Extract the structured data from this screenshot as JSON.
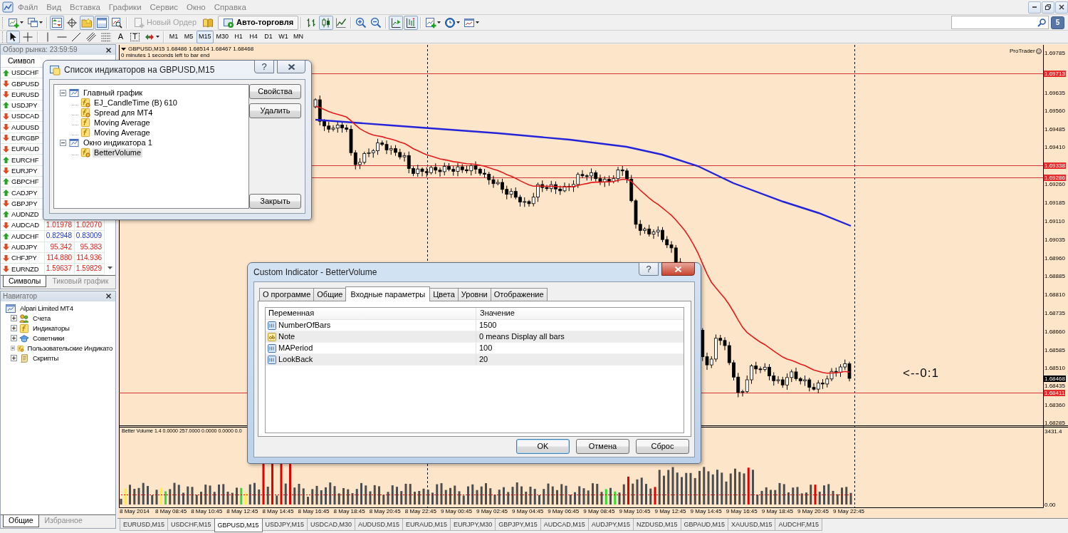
{
  "menu_bar": {
    "items": [
      {
        "label": "Файл"
      },
      {
        "label": "Вид"
      },
      {
        "label": "Вставка"
      },
      {
        "label": "Графики"
      },
      {
        "label": "Сервис"
      },
      {
        "label": "Окно"
      },
      {
        "label": "Справка"
      }
    ]
  },
  "toolbar_standard": {
    "groups": [
      [
        {
          "kind": "icon",
          "pressed": false
        },
        {
          "kind": "icon",
          "pressed": false
        }
      ],
      [
        {
          "kind": "icon",
          "pressed": true
        },
        {
          "kind": "icon",
          "pressed": false
        },
        {
          "kind": "icon",
          "pressed": true
        },
        {
          "kind": "icon",
          "pressed": true
        },
        {
          "kind": "icon",
          "pressed": false
        }
      ],
      [
        {
          "kind": "text",
          "label": "Новый Ордер",
          "disabled": true
        },
        {
          "kind": "icon",
          "pressed": false
        },
        {
          "kind": "text",
          "label": "Авто-торговля",
          "disabled": false
        }
      ],
      [
        {
          "kind": "icon",
          "pressed": false
        },
        {
          "kind": "icon",
          "pressed": true
        },
        {
          "kind": "icon",
          "pressed": false
        }
      ],
      [
        {
          "kind": "icon",
          "pressed": false
        },
        {
          "kind": "icon",
          "pressed": false
        }
      ],
      [
        {
          "kind": "icon",
          "pressed": true
        },
        {
          "kind": "icon",
          "pressed": true
        }
      ],
      [
        {
          "kind": "icon",
          "pressed": false
        },
        {
          "kind": "icon",
          "pressed": false
        },
        {
          "kind": "icon",
          "pressed": false
        }
      ]
    ]
  },
  "messages": {
    "count": "5"
  },
  "toolbar_tools": {
    "groups": [
      [
        {
          "kind": "icon",
          "pressed": true
        },
        {
          "kind": "icon",
          "pressed": false
        }
      ],
      [
        {
          "kind": "icon",
          "pressed": false
        },
        {
          "kind": "icon",
          "pressed": false
        },
        {
          "kind": "icon",
          "pressed": false
        },
        {
          "kind": "icon",
          "pressed": false
        },
        {
          "kind": "icon",
          "pressed": false
        },
        {
          "kind": "glyph",
          "glyph": "A",
          "pressed": false
        },
        {
          "kind": "glyph",
          "glyph": "T",
          "pressed": false
        },
        {
          "kind": "icon",
          "pressed": false
        }
      ]
    ]
  },
  "timeframes": [
    {
      "label": "M1",
      "selected": false
    },
    {
      "label": "M5",
      "selected": false
    },
    {
      "label": "M15",
      "selected": true
    },
    {
      "label": "M30",
      "selected": false
    },
    {
      "label": "H1",
      "selected": false
    },
    {
      "label": "H4",
      "selected": false
    },
    {
      "label": "D1",
      "selected": false
    },
    {
      "label": "W1",
      "selected": false
    },
    {
      "label": "MN",
      "selected": false
    }
  ],
  "market_watch": {
    "title": "Обзор рынка: 23:59:59",
    "columns": [
      "Символ"
    ],
    "rows": [
      {
        "symbol": "USDCHF",
        "rising": true,
        "selected": false
      },
      {
        "symbol": "GBPUSD",
        "rising": false,
        "selected": false
      },
      {
        "symbol": "EURUSD",
        "rising": false,
        "selected": false
      },
      {
        "symbol": "USDJPY",
        "rising": true,
        "selected": false
      },
      {
        "symbol": "USDCAD",
        "rising": false,
        "selected": false
      },
      {
        "symbol": "AUDUSD",
        "rising": false,
        "selected": false
      },
      {
        "symbol": "EURGBP",
        "rising": false,
        "selected": false
      },
      {
        "symbol": "EURAUD",
        "rising": false,
        "selected": false
      },
      {
        "symbol": "EURCHF",
        "rising": true,
        "selected": false
      },
      {
        "symbol": "EURJPY",
        "rising": false,
        "selected": false
      },
      {
        "symbol": "GBPCHF",
        "rising": true,
        "selected": false
      },
      {
        "symbol": "CADJPY",
        "rising": true,
        "selected": false
      },
      {
        "symbol": "GBPJPY",
        "rising": false,
        "selected": false
      },
      {
        "symbol": "AUDNZD",
        "rising": true,
        "selected": false
      },
      {
        "symbol": "AUDCAD",
        "rising": false,
        "bid": "1.01978",
        "ask": "1.02070",
        "selected": false
      },
      {
        "symbol": "AUDCHF",
        "rising": true,
        "bid": "0.82948",
        "ask": "0.83009",
        "selected": false
      },
      {
        "symbol": "AUDJPY",
        "rising": false,
        "bid": "95.342",
        "ask": "95.383",
        "selected": false
      },
      {
        "symbol": "CHFJPY",
        "rising": false,
        "bid": "114.880",
        "ask": "114.936",
        "selected": false
      },
      {
        "symbol": "EURNZD",
        "rising": false,
        "bid": "1.59637",
        "ask": "1.59829",
        "selected": false
      }
    ],
    "tabs": [
      {
        "label": "Символы",
        "selected": true
      },
      {
        "label": "Тиковый график",
        "selected": false
      }
    ]
  },
  "navigator": {
    "title": "Навигатор",
    "tree": [
      {
        "label": "Alpari Limited MT4",
        "selected": false,
        "children": [
          {
            "label": "Счета",
            "expanded": false,
            "selected": false
          },
          {
            "label": "Индикаторы",
            "expanded": false,
            "selected": false
          },
          {
            "label": "Советники",
            "expanded": false,
            "selected": false
          },
          {
            "label": "Пользовательские Индикато",
            "expanded": false,
            "selected": false
          },
          {
            "label": "Скрипты",
            "expanded": false,
            "selected": false
          }
        ]
      }
    ],
    "tabs": [
      {
        "label": "Общие",
        "selected": true
      },
      {
        "label": "Избранное",
        "selected": false
      }
    ]
  },
  "chart": {
    "title": "GBPUSD,M15 1.68486 1.68514 1.68467 1.68468",
    "timer": "0 minutes 1 seconds left to bar end",
    "brand": "ProTrader",
    "countdown": "<--0:1",
    "price_labels": [
      {
        "text": "1.69785",
        "kind": "tick"
      },
      {
        "text": "1.69713",
        "kind": "level"
      },
      {
        "text": "1.69635",
        "kind": "tick"
      },
      {
        "text": "1.69560",
        "kind": "tick"
      },
      {
        "text": "1.69485",
        "kind": "tick"
      },
      {
        "text": "1.69410",
        "kind": "tick"
      },
      {
        "text": "1.69338",
        "kind": "level"
      },
      {
        "text": "1.69286",
        "kind": "level"
      },
      {
        "text": "1.69260",
        "kind": "tick"
      },
      {
        "text": "1.69185",
        "kind": "tick"
      },
      {
        "text": "1.69110",
        "kind": "tick"
      },
      {
        "text": "1.69035",
        "kind": "tick"
      },
      {
        "text": "1.68960",
        "kind": "tick"
      },
      {
        "text": "1.68885",
        "kind": "tick"
      },
      {
        "text": "1.68810",
        "kind": "tick"
      },
      {
        "text": "1.68735",
        "kind": "tick"
      },
      {
        "text": "1.68660",
        "kind": "tick"
      },
      {
        "text": "1.68585",
        "kind": "tick"
      },
      {
        "text": "1.68510",
        "kind": "tick"
      },
      {
        "text": "1.68468",
        "kind": "bid"
      },
      {
        "text": "1.68435",
        "kind": "tick"
      },
      {
        "text": "1.68411",
        "kind": "level"
      },
      {
        "text": "1.68360",
        "kind": "tick"
      },
      {
        "text": "1.68285",
        "kind": "tick"
      }
    ],
    "indicator_title": "Better Volume 1.4 0.0000 257.0000 0.0000 0.0000 0.0",
    "indicator_scale": [
      "3431.4",
      "0.00"
    ],
    "time_labels": [
      "8 May 2014",
      "8 May 08:45",
      "8 May 10:45",
      "8 May 12:45",
      "8 May 14:45",
      "8 May 16:45",
      "8 May 18:45",
      "8 May 20:45",
      "8 May 22:45",
      "9 May 00:45",
      "9 May 02:45",
      "9 May 04:45",
      "9 May 06:45",
      "9 May 08:45",
      "9 May 10:45",
      "9 May 12:45",
      "9 May 14:45",
      "9 May 16:45",
      "9 May 18:45",
      "9 May 20:45",
      "9 May 22:45"
    ]
  },
  "chart_tabs": [
    {
      "label": "EURUSD,M15",
      "selected": false
    },
    {
      "label": "USDCHF,M15",
      "selected": false
    },
    {
      "label": "GBPUSD,M15",
      "selected": true
    },
    {
      "label": "USDJPY,M15",
      "selected": false
    },
    {
      "label": "USDCAD,M30",
      "selected": false
    },
    {
      "label": "AUDUSD,M15",
      "selected": false
    },
    {
      "label": "EURAUD,M15",
      "selected": false
    },
    {
      "label": "EURJPY,M30",
      "selected": false
    },
    {
      "label": "GBPJPY,M15",
      "selected": false
    },
    {
      "label": "AUDCAD,M15",
      "selected": false
    },
    {
      "label": "AUDJPY,M15",
      "selected": false
    },
    {
      "label": "NZDUSD,M15",
      "selected": false
    },
    {
      "label": "GBPAUD,M15",
      "selected": false
    },
    {
      "label": "XAUUSD,M15",
      "selected": false
    },
    {
      "label": "AUDCHF,M15",
      "selected": false
    }
  ],
  "indicator_list_dialog": {
    "title": "Список индикаторов на GBPUSD,M15",
    "active": false,
    "help": "?",
    "tree": [
      {
        "label": "Главный график",
        "kind": "window",
        "expanded": true,
        "selected": false,
        "children": [
          {
            "label": "EJ_CandleTime (B) 610",
            "kind": "custom",
            "selected": false
          },
          {
            "label": "Spread для MT4",
            "kind": "custom",
            "selected": false
          },
          {
            "label": "Moving Average",
            "kind": "builtin",
            "selected": false
          },
          {
            "label": "Moving Average",
            "kind": "builtin",
            "selected": false
          }
        ]
      },
      {
        "label": "Окно индикатора 1",
        "kind": "window",
        "expanded": true,
        "selected": false,
        "children": [
          {
            "label": "BetterVolume",
            "kind": "custom",
            "selected": true
          }
        ]
      }
    ],
    "buttons": [
      "Свойства",
      "Удалить",
      "Закрыть"
    ]
  },
  "custom_indicator_dialog": {
    "title": "Custom Indicator - BetterVolume",
    "active": true,
    "help": "?",
    "tabs": [
      {
        "label": "О программе",
        "selected": false
      },
      {
        "label": "Общие",
        "selected": false
      },
      {
        "label": "Входные параметры",
        "selected": true
      },
      {
        "label": "Цвета",
        "selected": false
      },
      {
        "label": "Уровни",
        "selected": false
      },
      {
        "label": "Отображение",
        "selected": false
      }
    ],
    "columns": [
      "Переменная",
      "Значение"
    ],
    "parameters": [
      {
        "kind": "int",
        "name": "NumberOfBars",
        "value": "1500"
      },
      {
        "kind": "string",
        "name": "Note",
        "value": "0 means Display all bars"
      },
      {
        "kind": "int",
        "name": "MAPeriod",
        "value": "100"
      },
      {
        "kind": "int",
        "name": "LookBack",
        "value": "20"
      }
    ],
    "buttons": [
      {
        "label": "OK",
        "default": true
      },
      {
        "label": "Отмена",
        "default": false
      },
      {
        "label": "Сброс",
        "default": false
      }
    ]
  }
}
